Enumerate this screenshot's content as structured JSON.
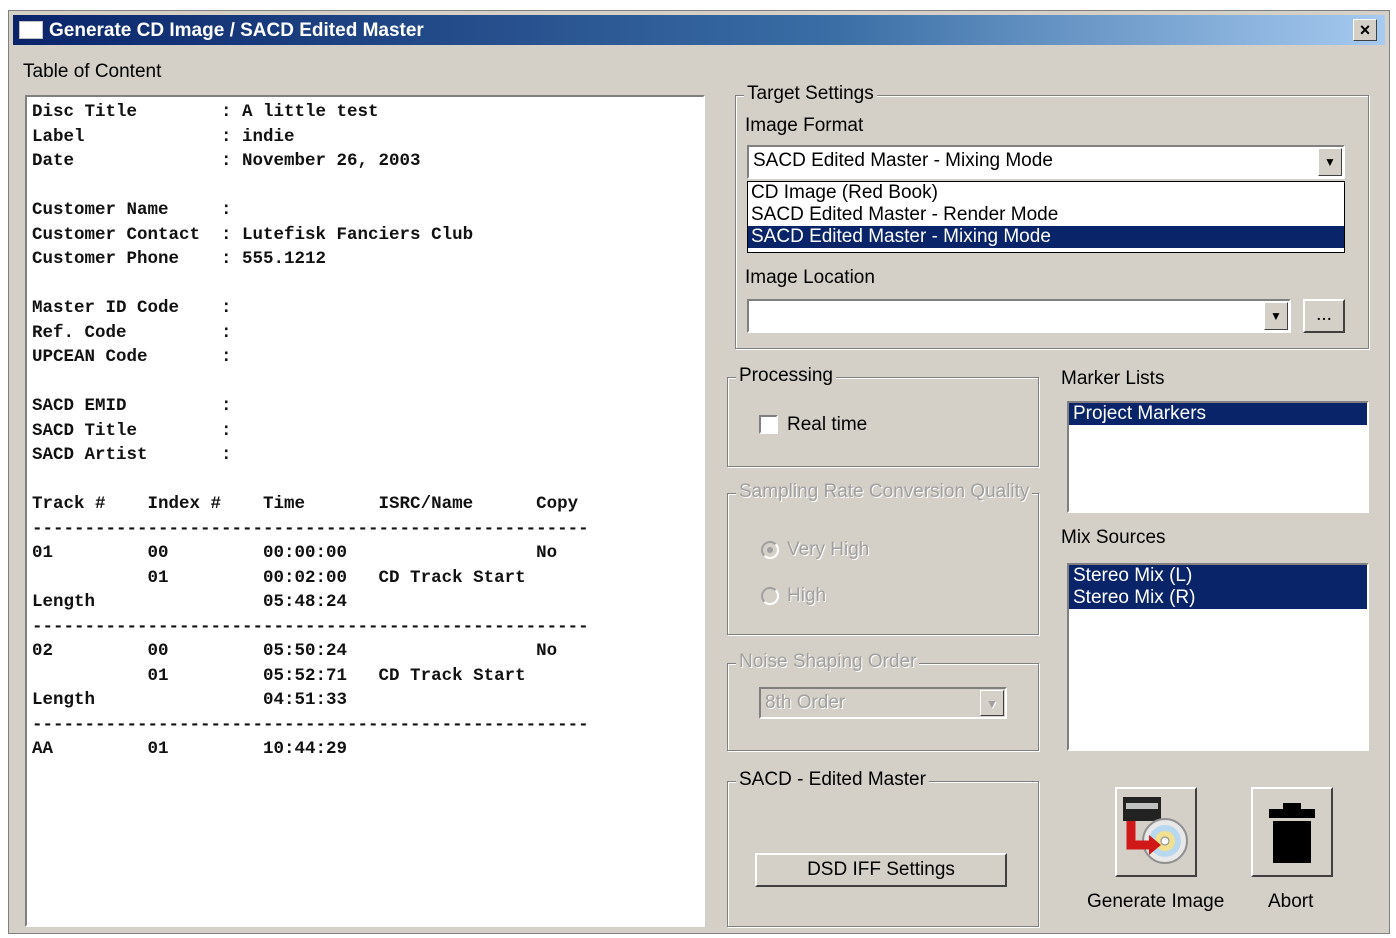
{
  "window": {
    "title": "Generate CD Image / SACD Edited Master",
    "close_label": "×"
  },
  "toc": {
    "label": "Table of Content",
    "text": "Disc Title        : A little test\nLabel             : indie\nDate              : November 26, 2003\n\nCustomer Name     :\nCustomer Contact  : Lutefisk Fanciers Club\nCustomer Phone    : 555.1212\n\nMaster ID Code    :\nRef. Code         :\nUPCEAN Code       :\n\nSACD EMID         :\nSACD Title        :\nSACD Artist       :\n\nTrack #    Index #    Time       ISRC/Name      Copy\n-----------------------------------------------------\n01         00         00:00:00                  No\n           01         00:02:00   CD Track Start\nLength                05:48:24\n-----------------------------------------------------\n02         00         05:50:24                  No\n           01         05:52:71   CD Track Start\nLength                04:51:33\n-----------------------------------------------------\nAA         01         10:44:29"
  },
  "target_settings": {
    "legend": "Target Settings",
    "image_format_label": "Image Format",
    "image_format_value": "SACD Edited Master - Mixing Mode",
    "image_format_options": [
      "CD Image (Red Book)",
      "SACD Edited Master - Render Mode",
      "SACD Edited Master - Mixing Mode"
    ],
    "image_location_label": "Image Location",
    "image_location_value": "",
    "browse_label": "..."
  },
  "processing": {
    "legend": "Processing",
    "realtime_label": "Real time",
    "realtime_checked": false
  },
  "src_quality": {
    "legend": "Sampling Rate Conversion Quality",
    "very_high_label": "Very High",
    "high_label": "High",
    "selected": "Very High"
  },
  "noise_shaping": {
    "legend": "Noise Shaping Order",
    "value": "8th Order"
  },
  "sacd_master": {
    "legend": "SACD - Edited Master",
    "dsd_button_label": "DSD IFF Settings"
  },
  "marker_lists": {
    "label": "Marker Lists",
    "items": [
      "Project Markers"
    ]
  },
  "mix_sources": {
    "label": "Mix Sources",
    "items": [
      "Stereo Mix (L)",
      "Stereo Mix (R)"
    ]
  },
  "actions": {
    "generate_label": "Generate Image",
    "abort_label": "Abort"
  }
}
